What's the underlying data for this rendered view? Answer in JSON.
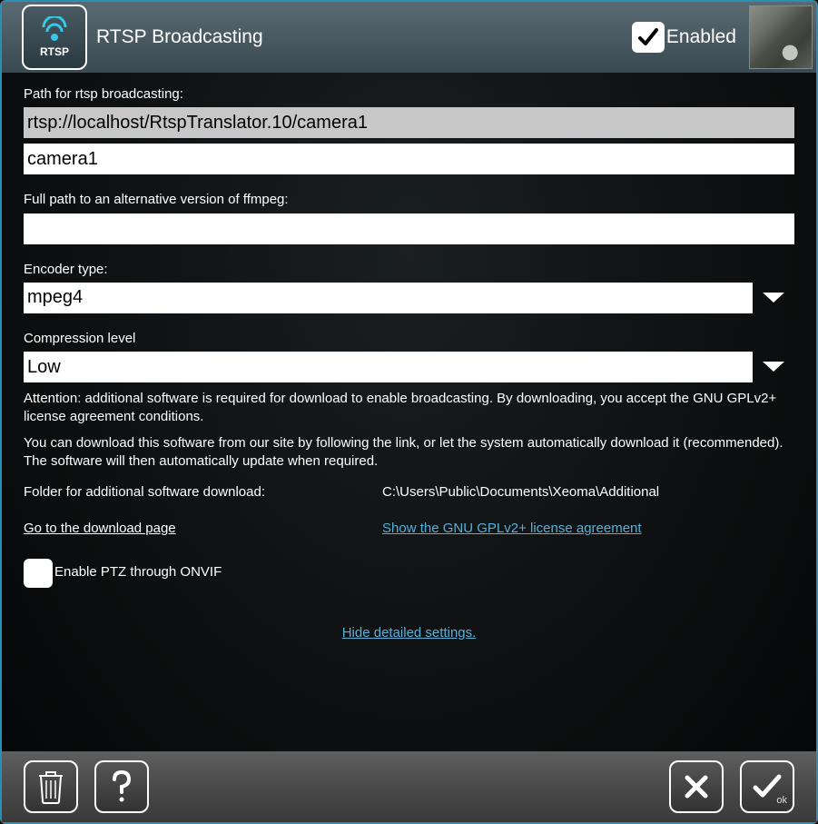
{
  "header": {
    "title": "RTSP Broadcasting",
    "icon_label": "RTSP",
    "enabled_label": "Enabled",
    "enabled_checked": true
  },
  "form": {
    "path_label": "Path for rtsp broadcasting:",
    "path_value": "rtsp://localhost/RtspTranslator.10/camera1",
    "camera_value": "camera1",
    "ffmpeg_label": "Full path to an alternative version of ffmpeg:",
    "ffmpeg_value": "",
    "encoder_label": "Encoder type:",
    "encoder_value": "mpeg4",
    "compression_label": "Compression level",
    "compression_value": "Low",
    "attention1": "Attention: additional software is required for download to enable broadcasting. By downloading, you accept the GNU GPLv2+ license agreement conditions.",
    "attention2": "You can download this software from our site by following the link, or let the system automatically download it (recommended). The software will then automatically update when required.",
    "folder_label": "Folder for additional software download:",
    "folder_value": "C:\\Users\\Public\\Documents\\Xeoma\\Additional",
    "download_link": "Go to the download page",
    "license_link": "Show the GNU GPLv2+ license agreement",
    "ptz_label": "Enable PTZ through ONVIF",
    "ptz_checked": false,
    "hide_link": "Hide detailed settings."
  },
  "footer": {
    "ok_label": "ok"
  }
}
